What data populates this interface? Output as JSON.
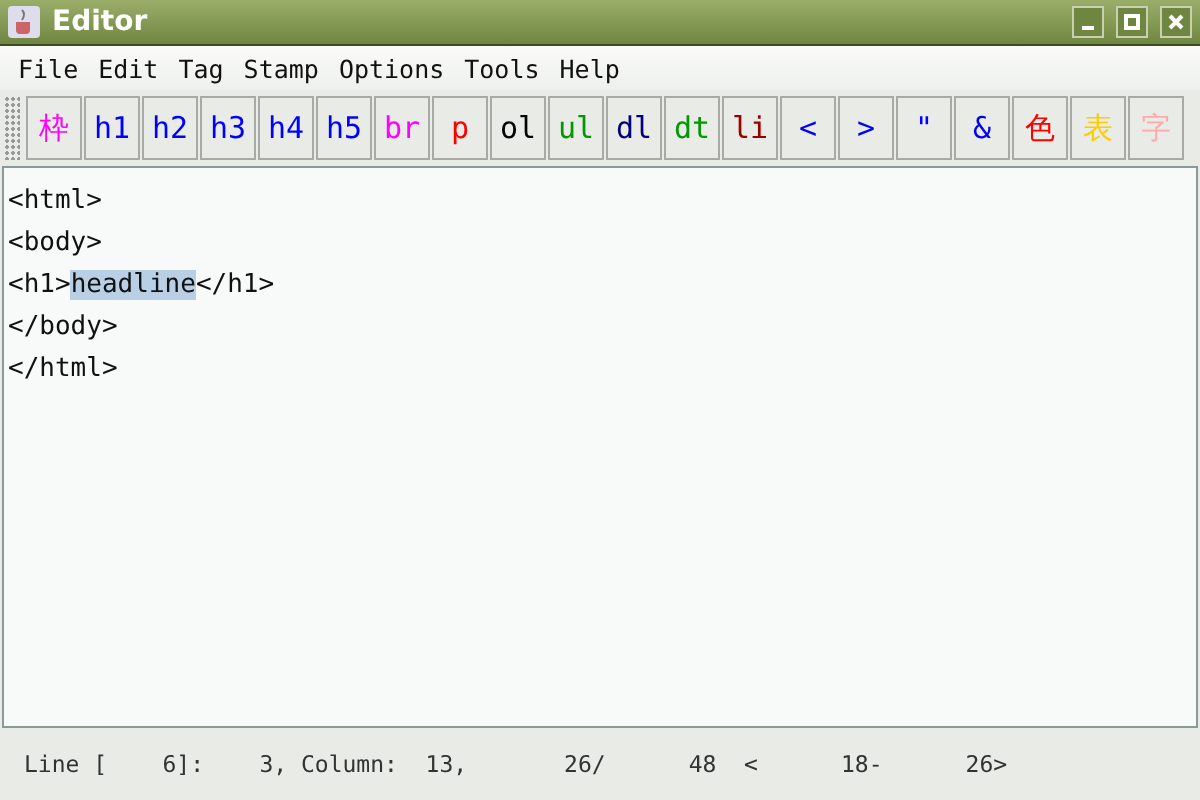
{
  "window": {
    "title": "Editor"
  },
  "menu": [
    "File",
    "Edit",
    "Tag",
    "Stamp",
    "Options",
    "Tools",
    "Help"
  ],
  "toolbar": [
    {
      "label": "枠",
      "color": "#ff00ff"
    },
    {
      "label": "h1",
      "color": "#0000ff"
    },
    {
      "label": "h2",
      "color": "#0000ff"
    },
    {
      "label": "h3",
      "color": "#0000ff"
    },
    {
      "label": "h4",
      "color": "#0000ff"
    },
    {
      "label": "h5",
      "color": "#0000ff"
    },
    {
      "label": "br",
      "color": "#ff00ff"
    },
    {
      "label": "p",
      "color": "#ff0000"
    },
    {
      "label": "ol",
      "color": "#000000"
    },
    {
      "label": "ul",
      "color": "#009900"
    },
    {
      "label": "dl",
      "color": "#000080"
    },
    {
      "label": "dt",
      "color": "#009900"
    },
    {
      "label": "li",
      "color": "#990000"
    },
    {
      "label": "<",
      "color": "#0000ff"
    },
    {
      "label": ">",
      "color": "#0000ff"
    },
    {
      "label": "\"",
      "color": "#0000ff"
    },
    {
      "label": "&",
      "color": "#0000ff"
    },
    {
      "label": "色",
      "color": "#ff0000"
    },
    {
      "label": "表",
      "color": "#ffcc00"
    },
    {
      "label": "字",
      "color": "#ffaaaa"
    }
  ],
  "editor": {
    "lines": [
      [
        {
          "text": "<html>",
          "selected": false
        }
      ],
      [
        {
          "text": "<body>",
          "selected": false
        }
      ],
      [
        {
          "text": "<h1>",
          "selected": false
        },
        {
          "text": "headline",
          "selected": true
        },
        {
          "text": "</h1>",
          "selected": false
        }
      ],
      [
        {
          "text": "</body>",
          "selected": false
        }
      ],
      [
        {
          "text": "</html>",
          "selected": false
        }
      ]
    ]
  },
  "status_bar": "Line [    6]:    3, Column:  13,       26/      48  <      18-      26>"
}
